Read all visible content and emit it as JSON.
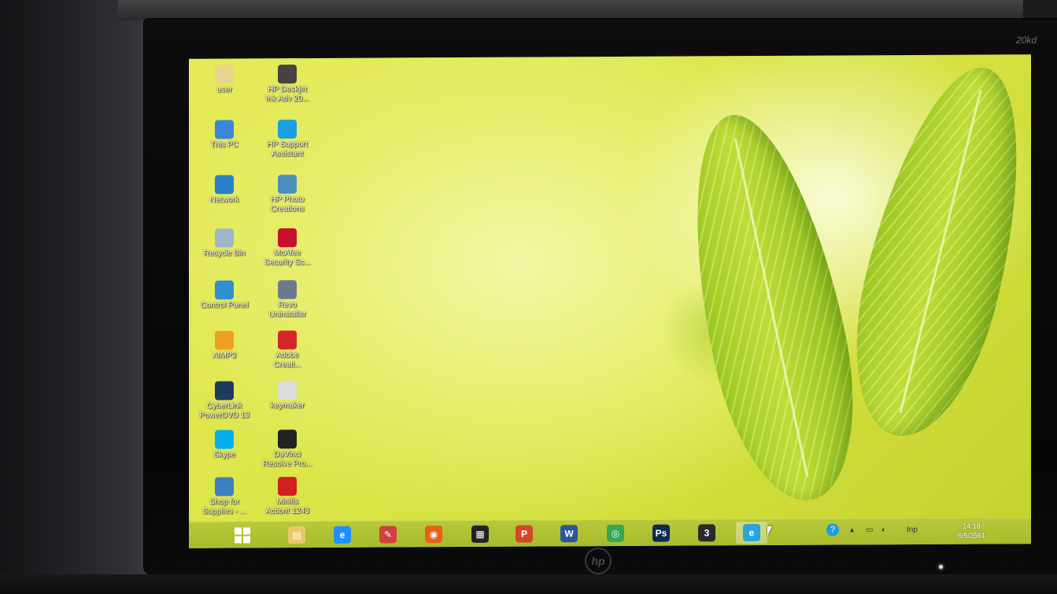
{
  "monitor": {
    "model_label": "20kd",
    "brand": "hp"
  },
  "desktop_icons": [
    {
      "label": "user",
      "icon": "user-folder-icon",
      "color": "#e8d48a"
    },
    {
      "label": "HP Deskjet\nInk Adv 20...",
      "icon": "printer-icon",
      "color": "#444444"
    },
    {
      "label": "This PC",
      "icon": "computer-icon",
      "color": "#3b86d8"
    },
    {
      "label": "HP Support\nAssistant",
      "icon": "help-icon",
      "color": "#1a9fe0"
    },
    {
      "label": "Network",
      "icon": "network-icon",
      "color": "#2a7fc9"
    },
    {
      "label": "HP Photo\nCreations",
      "icon": "photo-icon",
      "color": "#4a90c0"
    },
    {
      "label": "Recycle Bin",
      "icon": "recycle-bin-icon",
      "color": "#9fb7c9"
    },
    {
      "label": "McAfee\nSecurity Sc...",
      "icon": "mcafee-icon",
      "color": "#c8102e"
    },
    {
      "label": "Control Panel",
      "icon": "control-panel-icon",
      "color": "#2f8fd1"
    },
    {
      "label": "Revo\nUninstaller",
      "icon": "revo-icon",
      "color": "#6c7a90"
    },
    {
      "label": "AIMP3",
      "icon": "aimp-icon",
      "color": "#f0a020"
    },
    {
      "label": "Adobe\nCreati...",
      "icon": "adobe-icon",
      "color": "#d3262a"
    },
    {
      "label": "CyberLink\nPowerDVD 13",
      "icon": "powerdvd-icon",
      "color": "#1e3a5f"
    },
    {
      "label": "keymaker",
      "icon": "keymaker-icon",
      "color": "#dddddd"
    },
    {
      "label": "Skype",
      "icon": "skype-icon",
      "color": "#00aff0"
    },
    {
      "label": "DaVinci\nResolve Pro...",
      "icon": "davinci-icon",
      "color": "#222222"
    },
    {
      "label": "Shop for\nSupplies - ...",
      "icon": "shop-icon",
      "color": "#3d7fc0"
    },
    {
      "label": "Minilis\nAction! 1243",
      "icon": "action-icon",
      "color": "#d02020"
    }
  ],
  "taskbar": {
    "apps": [
      {
        "name": "file-explorer-icon",
        "glyph": "▤",
        "color": "#e9c86a",
        "active": false
      },
      {
        "name": "internet-explorer-icon",
        "glyph": "e",
        "color": "#1e90ff",
        "active": false
      },
      {
        "name": "paint-icon",
        "glyph": "✎",
        "color": "#d04040",
        "active": false
      },
      {
        "name": "firefox-icon",
        "glyph": "◉",
        "color": "#e8601c",
        "active": false
      },
      {
        "name": "media-player-icon",
        "glyph": "▦",
        "color": "#222222",
        "active": false
      },
      {
        "name": "powerpoint-icon",
        "glyph": "P",
        "color": "#d24726",
        "active": false
      },
      {
        "name": "word-icon",
        "glyph": "W",
        "color": "#2b579a",
        "active": false
      },
      {
        "name": "chrome-icon",
        "glyph": "◎",
        "color": "#34a853",
        "active": false
      },
      {
        "name": "photoshop-icon",
        "glyph": "Ps",
        "color": "#0c2b52",
        "active": false
      },
      {
        "name": "app-3-icon",
        "glyph": "3",
        "color": "#2a2a2a",
        "active": false
      },
      {
        "name": "edge-icon",
        "glyph": "e",
        "color": "#2aa3d8",
        "active": true
      }
    ],
    "tray": {
      "language": "Inp",
      "time": "14:18",
      "date": "6/5/2561"
    }
  }
}
